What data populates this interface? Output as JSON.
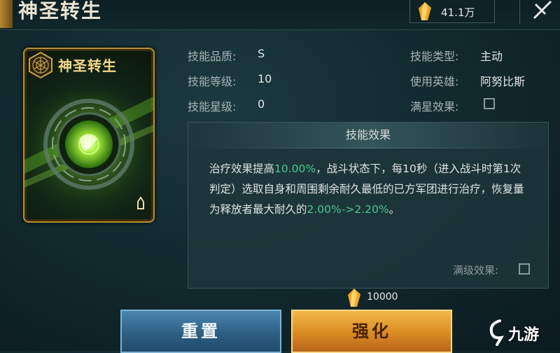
{
  "header": {
    "title": "神圣转生",
    "currency_value": "41.1万"
  },
  "card": {
    "title": "神圣转生",
    "accent_color": "#b8912e",
    "glow_color": "#9be64a"
  },
  "info": {
    "quality_label": "技能品质:",
    "quality_value": "S",
    "level_label": "技能等级:",
    "level_value": "10",
    "star_label": "技能星级:",
    "star_value": "0",
    "type_label": "技能类型:",
    "type_value": "主动",
    "hero_label": "使用英雄:",
    "hero_value": "阿努比斯",
    "full_star_label": "满星效果:"
  },
  "effect": {
    "header": "技能效果",
    "desc_1": "治疗效果提高",
    "desc_hl1": "10.00%",
    "desc_2": "，战斗状态下，每10秒（进入战斗时第1次判定）选取自身和周围剩余耐久最低的已方军团进行治疗，恢复量为释放者最大耐久的",
    "desc_hl2": "2.00%->2.20%",
    "desc_3": "。",
    "max_level_label": "满级效果:"
  },
  "cost": {
    "value": "10000"
  },
  "buttons": {
    "reset_label": "重置",
    "enhance_label": "强化"
  },
  "watermark": {
    "text": "九游"
  },
  "colors": {
    "highlight": "#49c98a",
    "reset_button": "#2d5f84",
    "enhance_button": "#d98b22"
  }
}
